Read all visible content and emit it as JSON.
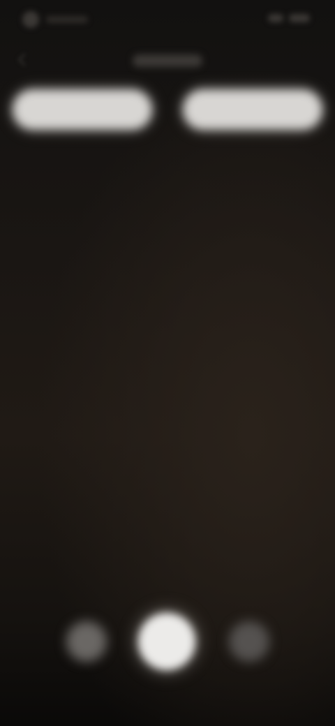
{
  "colors": {
    "background_top": "#121110",
    "background_mid": "#201a15",
    "button_fill": "#d8d6d3",
    "center_control_fill": "#ecebe9",
    "side_control_fill": "#6a6764"
  },
  "status_bar": {
    "left_icon": "status-indicator-icon",
    "right_icons": [
      "signal-icon",
      "battery-icon"
    ]
  },
  "header": {
    "back_icon": "back-arrow-icon"
  },
  "top_buttons": {
    "left_icon": "blurred-button",
    "right_icon": "blurred-button"
  },
  "bottom_controls": {
    "left_icon": "circle-button-icon",
    "center_icon": "shutter-button-icon",
    "right_icon": "circle-button-icon"
  }
}
